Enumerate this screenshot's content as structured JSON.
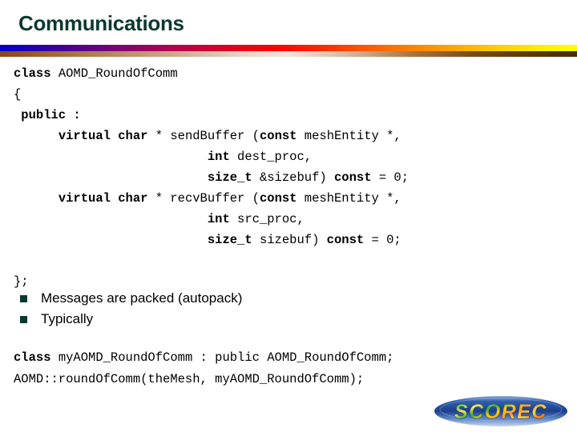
{
  "slide": {
    "title": "Communications",
    "accent_color": "#0c3830",
    "background_color": "#ffffff"
  },
  "divider": {
    "top_bar_gradient": [
      "#0000cc",
      "#7a0077",
      "#ff0000",
      "#ff9900",
      "#ffff00"
    ],
    "bottom_bar_gradient": [
      "#8b4513",
      "#e8d5c6",
      "#7a4a18",
      "#4a2a0c"
    ]
  },
  "code_top": {
    "lines": [
      [
        {
          "t": "class",
          "b": true
        },
        {
          "t": " AOMD_RoundOfComm",
          "b": false
        }
      ],
      [
        {
          "t": "{",
          "b": false
        }
      ],
      [
        {
          "t": " public :",
          "b": true
        }
      ],
      [
        {
          "t": "      ",
          "b": false
        },
        {
          "t": "virtual char",
          "b": true
        },
        {
          "t": " * sendBuffer (",
          "b": false
        },
        {
          "t": "const",
          "b": true
        },
        {
          "t": " meshEntity *,",
          "b": false
        }
      ],
      [
        {
          "t": "                          ",
          "b": false
        },
        {
          "t": "int",
          "b": true
        },
        {
          "t": " dest_proc,",
          "b": false
        }
      ],
      [
        {
          "t": "                          ",
          "b": false
        },
        {
          "t": "size_t",
          "b": true
        },
        {
          "t": " &sizebuf) ",
          "b": false
        },
        {
          "t": "const",
          "b": true
        },
        {
          "t": " = 0;",
          "b": false
        }
      ],
      [
        {
          "t": "      ",
          "b": false
        },
        {
          "t": "virtual char",
          "b": true
        },
        {
          "t": " * recvBuffer (",
          "b": false
        },
        {
          "t": "const",
          "b": true
        },
        {
          "t": " meshEntity *,",
          "b": false
        }
      ],
      [
        {
          "t": "                          ",
          "b": false
        },
        {
          "t": "int",
          "b": true
        },
        {
          "t": " src_proc,",
          "b": false
        }
      ],
      [
        {
          "t": "                          ",
          "b": false
        },
        {
          "t": "size_t",
          "b": true
        },
        {
          "t": " sizebuf) ",
          "b": false
        },
        {
          "t": "const",
          "b": true
        },
        {
          "t": " = 0;",
          "b": false
        }
      ],
      [
        {
          "t": "",
          "b": false
        }
      ],
      [
        {
          "t": "};",
          "b": false
        }
      ]
    ]
  },
  "bullets": {
    "marker_color": "#0c3830",
    "items": [
      {
        "label": "Messages are packed (autopack)"
      },
      {
        "label": "Typically"
      }
    ]
  },
  "code_bottom": {
    "lines": [
      [
        {
          "t": "class",
          "b": true
        },
        {
          "t": " myAOMD_RoundOfComm : public AOMD_RoundOfComm;",
          "b": false
        }
      ],
      [
        {
          "t": "AOMD::roundOfComm(theMesh, myAOMD_RoundOfComm);",
          "b": false
        }
      ]
    ]
  },
  "logo": {
    "text": "SCOREC",
    "ellipse_color": "#2f5fb0",
    "text_colors": [
      "#2eb82e",
      "#ffd700",
      "#ff8c1a"
    ]
  }
}
